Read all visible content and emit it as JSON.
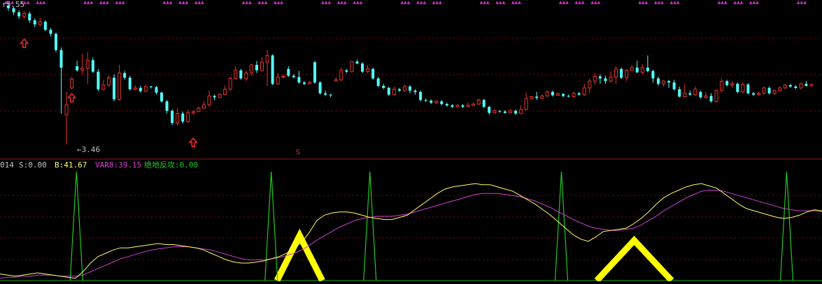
{
  "colors": {
    "background": "#000000",
    "up": "#e8342c",
    "down": "#54ffff",
    "grid": "#7a1010",
    "divider": "#9a1010",
    "text": "#c0c0c0",
    "b_line": "#ffff66",
    "var8_line": "#d040d0",
    "spike": "#22c822",
    "yellow_block": "#ffff00",
    "top_marker": "#d030d0",
    "arrow": "#ff2a2a"
  },
  "price_panel": {
    "high_label": "5.55",
    "low_label": "←3.46",
    "signal_label": "S",
    "top_markers_label": "▲▲▲"
  },
  "indicator_panel": {
    "code_label": "014",
    "s_label": "S:0.00",
    "b_label": "B:41.67",
    "var8_label": "VAR8:39.15",
    "jd_label": "绝地反攻:0.00"
  },
  "chart_data": {
    "type": "candlestick",
    "ylim": [
      3.4,
      5.55
    ],
    "candles": [
      [
        5.52,
        5.48,
        5.55,
        5.44
      ],
      [
        5.48,
        5.42,
        5.5,
        5.38
      ],
      [
        5.42,
        5.36,
        5.45,
        5.32
      ],
      [
        5.36,
        5.4,
        5.44,
        5.32
      ],
      [
        5.4,
        5.3,
        5.43,
        5.26
      ],
      [
        5.3,
        5.24,
        5.33,
        5.2
      ],
      [
        5.24,
        5.28,
        5.34,
        5.21
      ],
      [
        5.28,
        5.16,
        5.3,
        5.14
      ],
      [
        5.16,
        5.1,
        5.19,
        5.06
      ],
      [
        5.1,
        4.86,
        5.12,
        4.83
      ],
      [
        4.86,
        4.6,
        4.9,
        3.92
      ],
      [
        3.9,
        4.05,
        4.24,
        3.46
      ],
      [
        4.3,
        4.43,
        4.46,
        4.28
      ],
      [
        4.62,
        4.56,
        4.7,
        4.54
      ],
      [
        4.56,
        4.59,
        4.8,
        4.5
      ],
      [
        4.59,
        4.71,
        4.83,
        4.36
      ],
      [
        4.71,
        4.54,
        4.75,
        4.52
      ],
      [
        4.54,
        4.28,
        4.58,
        4.25
      ],
      [
        4.28,
        4.34,
        4.42,
        4.26
      ],
      [
        4.34,
        4.45,
        4.48,
        4.32
      ],
      [
        4.45,
        4.13,
        4.5,
        4.1
      ],
      [
        4.13,
        4.52,
        4.64,
        4.11
      ],
      [
        4.52,
        4.45,
        4.55,
        4.42
      ],
      [
        4.45,
        4.28,
        4.48,
        4.26
      ],
      [
        4.28,
        4.3,
        4.34,
        4.26
      ],
      [
        4.3,
        4.25,
        4.33,
        4.23
      ],
      [
        4.25,
        4.32,
        4.34,
        4.24
      ],
      [
        4.32,
        4.31,
        4.33,
        4.29
      ],
      [
        4.31,
        4.23,
        4.33,
        4.2
      ],
      [
        4.23,
        4.1,
        4.24,
        4.08
      ],
      [
        4.1,
        3.96,
        4.12,
        3.92
      ],
      [
        3.96,
        3.78,
        3.98,
        3.75
      ],
      [
        3.78,
        3.92,
        4.0,
        3.74
      ],
      [
        3.92,
        3.8,
        3.95,
        3.77
      ],
      [
        3.8,
        3.93,
        3.98,
        3.78
      ],
      [
        3.93,
        3.95,
        3.97,
        3.9
      ],
      [
        3.95,
        4.0,
        4.02,
        3.94
      ],
      [
        4.0,
        4.05,
        4.1,
        3.99
      ],
      [
        4.05,
        4.18,
        4.26,
        4.02
      ],
      [
        4.18,
        4.16,
        4.2,
        4.12
      ],
      [
        4.16,
        4.2,
        4.22,
        4.15
      ],
      [
        4.2,
        4.28,
        4.34,
        4.19
      ],
      [
        4.28,
        4.44,
        4.47,
        4.26
      ],
      [
        4.44,
        4.56,
        4.62,
        4.42
      ],
      [
        4.56,
        4.44,
        4.58,
        4.42
      ],
      [
        4.44,
        4.52,
        4.56,
        4.4
      ],
      [
        4.52,
        4.64,
        4.66,
        4.48
      ],
      [
        4.64,
        4.56,
        4.7,
        4.52
      ],
      [
        4.56,
        4.68,
        4.75,
        4.54
      ],
      [
        4.68,
        4.78,
        4.86,
        4.33
      ],
      [
        4.78,
        4.36,
        4.8,
        4.34
      ],
      [
        4.36,
        4.46,
        4.52,
        4.34
      ],
      [
        4.46,
        4.47,
        4.5,
        4.44
      ],
      [
        4.58,
        4.48,
        4.62,
        4.46
      ],
      [
        4.48,
        4.46,
        4.5,
        4.44
      ],
      [
        4.46,
        4.38,
        4.55,
        4.36
      ],
      [
        4.38,
        4.36,
        4.4,
        4.34
      ],
      [
        4.36,
        4.38,
        4.4,
        4.36
      ],
      [
        4.68,
        4.38,
        4.7,
        4.36
      ],
      [
        4.38,
        4.22,
        4.4,
        4.2
      ],
      [
        4.22,
        4.2,
        4.26,
        4.18
      ],
      [
        4.2,
        4.19,
        4.21,
        4.16
      ],
      [
        4.4,
        4.42,
        4.46,
        4.4
      ],
      [
        4.42,
        4.56,
        4.6,
        4.4
      ],
      [
        4.56,
        4.54,
        4.58,
        4.52
      ],
      [
        4.54,
        4.69,
        4.7,
        4.53
      ],
      [
        4.69,
        4.66,
        4.72,
        4.65
      ],
      [
        4.66,
        4.54,
        4.68,
        4.52
      ],
      [
        4.54,
        4.58,
        4.64,
        4.52
      ],
      [
        4.58,
        4.44,
        4.6,
        4.42
      ],
      [
        4.44,
        4.33,
        4.46,
        4.31
      ],
      [
        4.33,
        4.3,
        4.36,
        4.28
      ],
      [
        4.3,
        4.2,
        4.32,
        4.18
      ],
      [
        4.2,
        4.28,
        4.32,
        4.18
      ],
      [
        4.28,
        4.26,
        4.3,
        4.24
      ],
      [
        4.26,
        4.32,
        4.34,
        4.24
      ],
      [
        4.32,
        4.26,
        4.34,
        4.22
      ],
      [
        4.26,
        4.24,
        4.28,
        4.2
      ],
      [
        4.24,
        4.12,
        4.26,
        4.1
      ],
      [
        4.12,
        4.11,
        4.14,
        4.09
      ],
      [
        4.11,
        4.08,
        4.13,
        4.06
      ],
      [
        4.08,
        4.1,
        4.12,
        4.06
      ],
      [
        4.1,
        4.06,
        4.12,
        4.04
      ],
      [
        4.06,
        4.04,
        4.08,
        4.02
      ],
      [
        4.04,
        4.02,
        4.06,
        4.0
      ],
      [
        4.02,
        4.04,
        4.06,
        4.02
      ],
      [
        4.04,
        4.02,
        4.06,
        4.0
      ],
      [
        4.02,
        4.04,
        4.08,
        4.02
      ],
      [
        4.04,
        4.06,
        4.08,
        4.04
      ],
      [
        4.06,
        4.12,
        4.14,
        4.05
      ],
      [
        4.12,
        4.02,
        4.14,
        4.0
      ],
      [
        4.02,
        3.93,
        4.03,
        3.9
      ],
      [
        3.93,
        3.96,
        3.98,
        3.92
      ],
      [
        3.96,
        3.95,
        3.97,
        3.93
      ],
      [
        3.95,
        3.93,
        3.97,
        3.92
      ],
      [
        3.93,
        3.96,
        3.98,
        3.92
      ],
      [
        3.96,
        3.92,
        3.98,
        3.9
      ],
      [
        3.92,
        3.98,
        4.04,
        3.91
      ],
      [
        3.98,
        4.14,
        4.23,
        3.97
      ],
      [
        4.14,
        4.17,
        4.18,
        4.14
      ],
      [
        4.17,
        4.15,
        4.24,
        4.12
      ],
      [
        4.15,
        4.18,
        4.2,
        4.13
      ],
      [
        4.18,
        4.24,
        4.26,
        4.16
      ],
      [
        4.24,
        4.19,
        4.26,
        4.17
      ],
      [
        4.19,
        4.21,
        4.23,
        4.19
      ],
      [
        4.21,
        4.18,
        4.22,
        4.16
      ],
      [
        4.18,
        4.17,
        4.2,
        4.16
      ],
      [
        4.17,
        4.22,
        4.24,
        4.16
      ],
      [
        4.22,
        4.2,
        4.24,
        4.18
      ],
      [
        4.2,
        4.3,
        4.36,
        4.18
      ],
      [
        4.3,
        4.4,
        4.44,
        4.22
      ],
      [
        4.4,
        4.47,
        4.52,
        4.35
      ],
      [
        4.47,
        4.44,
        4.5,
        4.36
      ],
      [
        4.44,
        4.4,
        4.48,
        4.36
      ],
      [
        4.4,
        4.46,
        4.54,
        4.38
      ],
      [
        4.46,
        4.58,
        4.62,
        4.36
      ],
      [
        4.58,
        4.45,
        4.6,
        4.43
      ],
      [
        4.45,
        4.56,
        4.58,
        4.4
      ],
      [
        4.56,
        4.6,
        4.64,
        4.58
      ],
      [
        4.6,
        4.53,
        4.7,
        4.52
      ],
      [
        4.53,
        4.6,
        4.65,
        4.5
      ],
      [
        4.6,
        4.55,
        4.78,
        4.53
      ],
      [
        4.55,
        4.44,
        4.57,
        4.38
      ],
      [
        4.44,
        4.36,
        4.47,
        4.33
      ],
      [
        4.36,
        4.4,
        4.42,
        4.32
      ],
      [
        4.4,
        4.38,
        4.42,
        4.3
      ],
      [
        4.38,
        4.28,
        4.42,
        4.26
      ],
      [
        4.28,
        4.17,
        4.32,
        4.16
      ],
      [
        4.17,
        4.22,
        4.35,
        4.16
      ],
      [
        4.22,
        4.2,
        4.26,
        4.18
      ],
      [
        4.2,
        4.28,
        4.32,
        4.18
      ],
      [
        4.24,
        4.16,
        4.26,
        4.14
      ],
      [
        4.16,
        4.18,
        4.24,
        4.14
      ],
      [
        4.18,
        4.1,
        4.22,
        4.08
      ],
      [
        4.1,
        4.26,
        4.28,
        4.08
      ],
      [
        4.26,
        4.4,
        4.44,
        4.24
      ],
      [
        4.4,
        4.34,
        4.42,
        4.32
      ],
      [
        4.34,
        4.36,
        4.4,
        4.3
      ],
      [
        4.36,
        4.24,
        4.38,
        4.22
      ],
      [
        4.24,
        4.35,
        4.38,
        4.22
      ],
      [
        4.35,
        4.22,
        4.37,
        4.2
      ],
      [
        4.22,
        4.2,
        4.24,
        4.18
      ],
      [
        4.2,
        4.22,
        4.24,
        4.18
      ],
      [
        4.22,
        4.3,
        4.32,
        4.2
      ],
      [
        4.3,
        4.22,
        4.32,
        4.2
      ],
      [
        4.22,
        4.26,
        4.28,
        4.2
      ],
      [
        4.26,
        4.3,
        4.32,
        4.24
      ],
      [
        4.3,
        4.34,
        4.36,
        4.28
      ],
      [
        4.34,
        4.32,
        4.36,
        4.3
      ],
      [
        4.32,
        4.3,
        4.34,
        4.28
      ],
      [
        4.3,
        4.36,
        4.38,
        4.28
      ],
      [
        4.36,
        4.33,
        4.4,
        4.32
      ],
      [
        4.33,
        4.35,
        4.36,
        4.33
      ]
    ],
    "indicator": {
      "ylim": [
        0,
        100
      ],
      "b_series": [
        6,
        5,
        4,
        5,
        6,
        7,
        6,
        5,
        4,
        3,
        2,
        8,
        16,
        22,
        25,
        28,
        30,
        30,
        31,
        32,
        33,
        34,
        33,
        33,
        32,
        31,
        30,
        28,
        25,
        22,
        19,
        17,
        16,
        16,
        17,
        18,
        20,
        22,
        25,
        30,
        35,
        44,
        55,
        60,
        62,
        63,
        63,
        62,
        60,
        58,
        57,
        56,
        56,
        58,
        60,
        65,
        70,
        75,
        80,
        84,
        86,
        87,
        88,
        89,
        88,
        88,
        86,
        84,
        82,
        78,
        74,
        70,
        65,
        60,
        54,
        48,
        42,
        38,
        36,
        40,
        45,
        46,
        47,
        48,
        52,
        57,
        63,
        70,
        76,
        80,
        83,
        86,
        88,
        89,
        87,
        85,
        80,
        75,
        70,
        66,
        64,
        62,
        60,
        58,
        57,
        58,
        60,
        63,
        65,
        64
      ],
      "var8_series": [
        2,
        3,
        3,
        4,
        4,
        5,
        5,
        5,
        4,
        4,
        4,
        5,
        8,
        11,
        14,
        17,
        20,
        22,
        24,
        26,
        28,
        29,
        30,
        31,
        31,
        31,
        30,
        29,
        28,
        26,
        24,
        22,
        20,
        19,
        19,
        19,
        20,
        21,
        23,
        25,
        28,
        32,
        37,
        41,
        45,
        49,
        52,
        55,
        57,
        58,
        59,
        59,
        59,
        60,
        61,
        63,
        65,
        67,
        69,
        71,
        73,
        75,
        77,
        79,
        80,
        80,
        80,
        79,
        78,
        77,
        75,
        73,
        70,
        67,
        63,
        60,
        56,
        53,
        50,
        48,
        47,
        46,
        46,
        47,
        48,
        51,
        55,
        59,
        64,
        68,
        72,
        76,
        79,
        82,
        83,
        83,
        82,
        80,
        78,
        76,
        74,
        72,
        70,
        68,
        66,
        65,
        64,
        64,
        64,
        63
      ],
      "spike_positions": [
        0.093,
        0.33,
        0.45,
        0.683,
        0.957
      ],
      "yellow_blocks": [
        {
          "start": 0.337,
          "end": 0.392,
          "peak": 0.25
        },
        {
          "start": 0.726,
          "end": 0.817,
          "peak": 0.33
        }
      ]
    }
  }
}
